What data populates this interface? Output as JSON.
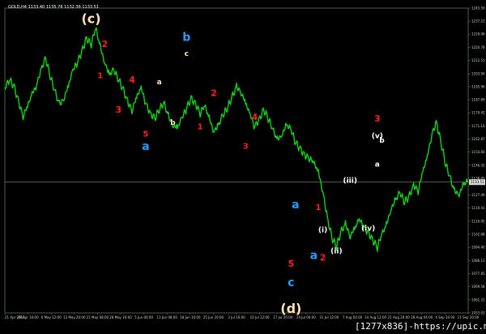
{
  "symbol_info": "GOLD,H4  1133.40 1135.76 1132.36 1133.51",
  "bid_label": "1133.51",
  "footer": "[1277x836]-https://upic.me/",
  "colors": {
    "background": "#000000",
    "price_line": "#16d11a",
    "grid": "#5f6f5f",
    "axis_text": "#cfcfcf",
    "red": "#ff2020",
    "blue": "#2c9cff",
    "white": "#ffffff",
    "cream": "#ffe5b8",
    "purple": "#9060ff",
    "cyan": "#55c0ff"
  },
  "chart_data": {
    "type": "line",
    "title": "",
    "series": [
      {
        "values": [
          1196,
          1202,
          1198,
          1188,
          1178,
          1184,
          1192,
          1199,
          1210,
          1216,
          1204,
          1194,
          1186,
          1190,
          1198,
          1208,
          1214,
          1222,
          1230,
          1226,
          1236,
          1224,
          1214,
          1206,
          1208,
          1202,
          1196,
          1188,
          1182,
          1190,
          1196,
          1187,
          1180,
          1176,
          1182,
          1186,
          1178,
          1172,
          1170,
          1176,
          1183,
          1190,
          1186,
          1180,
          1184,
          1176,
          1168,
          1172,
          1178,
          1183,
          1190,
          1198,
          1194,
          1186,
          1178,
          1171,
          1176,
          1182,
          1176,
          1168,
          1162,
          1166,
          1172,
          1168,
          1160,
          1156,
          1152,
          1150,
          1146,
          1140,
          1128,
          1110,
          1096,
          1090,
          1100,
          1106,
          1098,
          1102,
          1108,
          1104,
          1100,
          1095,
          1090,
          1098,
          1105,
          1116,
          1122,
          1126,
          1120,
          1124,
          1132,
          1128,
          1140,
          1150,
          1166,
          1174,
          1160,
          1146,
          1136,
          1128,
          1126,
          1132,
          1133.51
        ]
      }
    ],
    "ylim": [
      1046,
      1250
    ],
    "y_ticks": [
      "1245.50",
      "1237.23",
      "1229.06",
      "1220.78",
      "1212.51",
      "1203.94",
      "1195.96",
      "1187.69",
      "1179.42",
      "1171.14",
      "1162.87",
      "1154.60",
      "1146.32",
      "1138.05",
      "1127.49",
      "1119.41",
      "1110.95",
      "1102.68",
      "1094.40",
      "1086.13",
      "1077.85",
      "1069.58",
      "1061.31",
      "1053.03"
    ],
    "x_ticks": [
      "21 Apr 2015",
      "29 Apr 16:00",
      "6 May 12:00",
      "13 May 20:00",
      "21 May 08:00",
      "28 May 16:00",
      "5 Jun 00:00",
      "11 Jun 08:00",
      "18 Jun 16:00",
      "25 Jun 20:00",
      "3 Jul 16:00",
      "10 Jul 12:00",
      "17 Jul 20:00",
      "24 Jul 00:00",
      "31 Jul 12:00",
      "7 Aug 04:00",
      "14 Aug 12:00",
      "21 Aug 20:00",
      "28 Aug 04:00",
      "4 Sep 16:00",
      "11 Sep 20:00"
    ],
    "wave_labels": [
      {
        "text": "(c)",
        "color": "cream",
        "idx": 19,
        "price": 1240,
        "size": 16
      },
      {
        "text": "2",
        "color": "red",
        "idx": 22,
        "price": 1224,
        "size": 11
      },
      {
        "text": "1",
        "color": "red",
        "idx": 21,
        "price": 1203,
        "size": 10
      },
      {
        "text": "3",
        "color": "red",
        "idx": 25,
        "price": 1180,
        "size": 11
      },
      {
        "text": "4",
        "color": "red",
        "idx": 28,
        "price": 1200,
        "size": 11
      },
      {
        "text": "5",
        "color": "red",
        "idx": 31,
        "price": 1164,
        "size": 10
      },
      {
        "text": "a",
        "color": "blue",
        "idx": 31,
        "price": 1155,
        "size": 14
      },
      {
        "text": "a",
        "color": "cream",
        "idx": 34,
        "price": 1199,
        "size": 9
      },
      {
        "text": "b",
        "color": "cream",
        "idx": 37,
        "price": 1172,
        "size": 9
      },
      {
        "text": "b",
        "color": "blue",
        "idx": 40,
        "price": 1228,
        "size": 14
      },
      {
        "text": "c",
        "color": "cream",
        "idx": 40,
        "price": 1218,
        "size": 9
      },
      {
        "text": "1",
        "color": "red",
        "idx": 43,
        "price": 1169,
        "size": 10
      },
      {
        "text": "2",
        "color": "red",
        "idx": 46,
        "price": 1191,
        "size": 11
      },
      {
        "text": "3",
        "color": "red",
        "idx": 53,
        "price": 1156,
        "size": 10
      },
      {
        "text": "4",
        "color": "red",
        "idx": 55,
        "price": 1175,
        "size": 11
      },
      {
        "text": "5",
        "color": "red",
        "idx": 63,
        "price": 1077,
        "size": 11
      },
      {
        "text": "c",
        "color": "blue",
        "idx": 63,
        "price": 1064,
        "size": 14
      },
      {
        "text": "(d)",
        "color": "cream",
        "idx": 63,
        "price": 1046,
        "size": 16
      },
      {
        "text": "a",
        "color": "blue",
        "idx": 64,
        "price": 1116,
        "size": 14
      },
      {
        "text": "1",
        "color": "red",
        "idx": 69,
        "price": 1115,
        "size": 10
      },
      {
        "text": "(i)",
        "color": "white",
        "idx": 70,
        "price": 1100,
        "size": 9
      },
      {
        "text": "a",
        "color": "blue",
        "idx": 68,
        "price": 1082,
        "size": 14
      },
      {
        "text": "2",
        "color": "red",
        "idx": 70,
        "price": 1081,
        "size": 11
      },
      {
        "text": "(ii)",
        "color": "white",
        "idx": 73,
        "price": 1086,
        "size": 9
      },
      {
        "text": "(iii)",
        "color": "white",
        "idx": 76,
        "price": 1133,
        "size": 9
      },
      {
        "text": "(iv)",
        "color": "white",
        "idx": 80,
        "price": 1101,
        "size": 9
      },
      {
        "text": "3",
        "color": "red",
        "idx": 82,
        "price": 1174,
        "size": 11
      },
      {
        "text": "(v)",
        "color": "white",
        "idx": 82,
        "price": 1163,
        "size": 9
      },
      {
        "text": "b",
        "color": "white",
        "idx": 83,
        "price": 1160,
        "size": 9
      },
      {
        "text": "a",
        "color": "white",
        "idx": 82,
        "price": 1144,
        "size": 9
      }
    ]
  }
}
